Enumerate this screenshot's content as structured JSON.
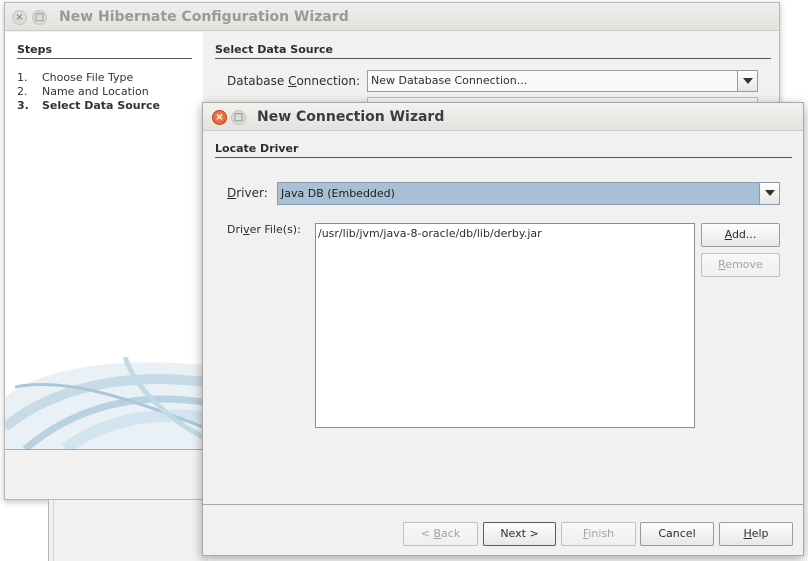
{
  "background_wizard": {
    "title": "New Hibernate Configuration Wizard",
    "steps_heading": "Steps",
    "steps": [
      {
        "num": "1.",
        "label": "Choose File Type",
        "current": false
      },
      {
        "num": "2.",
        "label": "Name and Location",
        "current": false
      },
      {
        "num": "3.",
        "label": "Select Data Source",
        "current": true
      }
    ],
    "section_title": "Select Data Source",
    "db_connection": {
      "label_pre": "Database ",
      "label_mnemonic": "C",
      "label_post": "onnection:",
      "value": "New Database Connection..."
    }
  },
  "dialog": {
    "title": "New Connection Wizard",
    "section_title": "Locate Driver",
    "driver": {
      "label_mnemonic": "D",
      "label_post": "river:",
      "value": "Java DB (Embedded)"
    },
    "driver_files": {
      "label_pre": "Dri",
      "label_mnemonic": "v",
      "label_post": "er File(s):",
      "items": [
        "/usr/lib/jvm/java-8-oracle/db/lib/derby.jar"
      ]
    },
    "add_button": {
      "mnemonic": "A",
      "rest": "dd..."
    },
    "remove_button": {
      "mnemonic": "R",
      "rest": "emove"
    },
    "footer": {
      "back": {
        "pre": "< ",
        "mnemonic": "B",
        "rest": "ack"
      },
      "next": "Next >",
      "finish": {
        "mnemonic": "F",
        "rest": "inish"
      },
      "cancel": "Cancel",
      "help": {
        "mnemonic": "H",
        "rest": "elp"
      }
    }
  },
  "icons": {
    "close": "×",
    "maximize": "□"
  },
  "colors": {
    "selected_combo": "#a8bfd6",
    "close_button": "#e0542a",
    "window_bg": "#f2f1ef"
  }
}
